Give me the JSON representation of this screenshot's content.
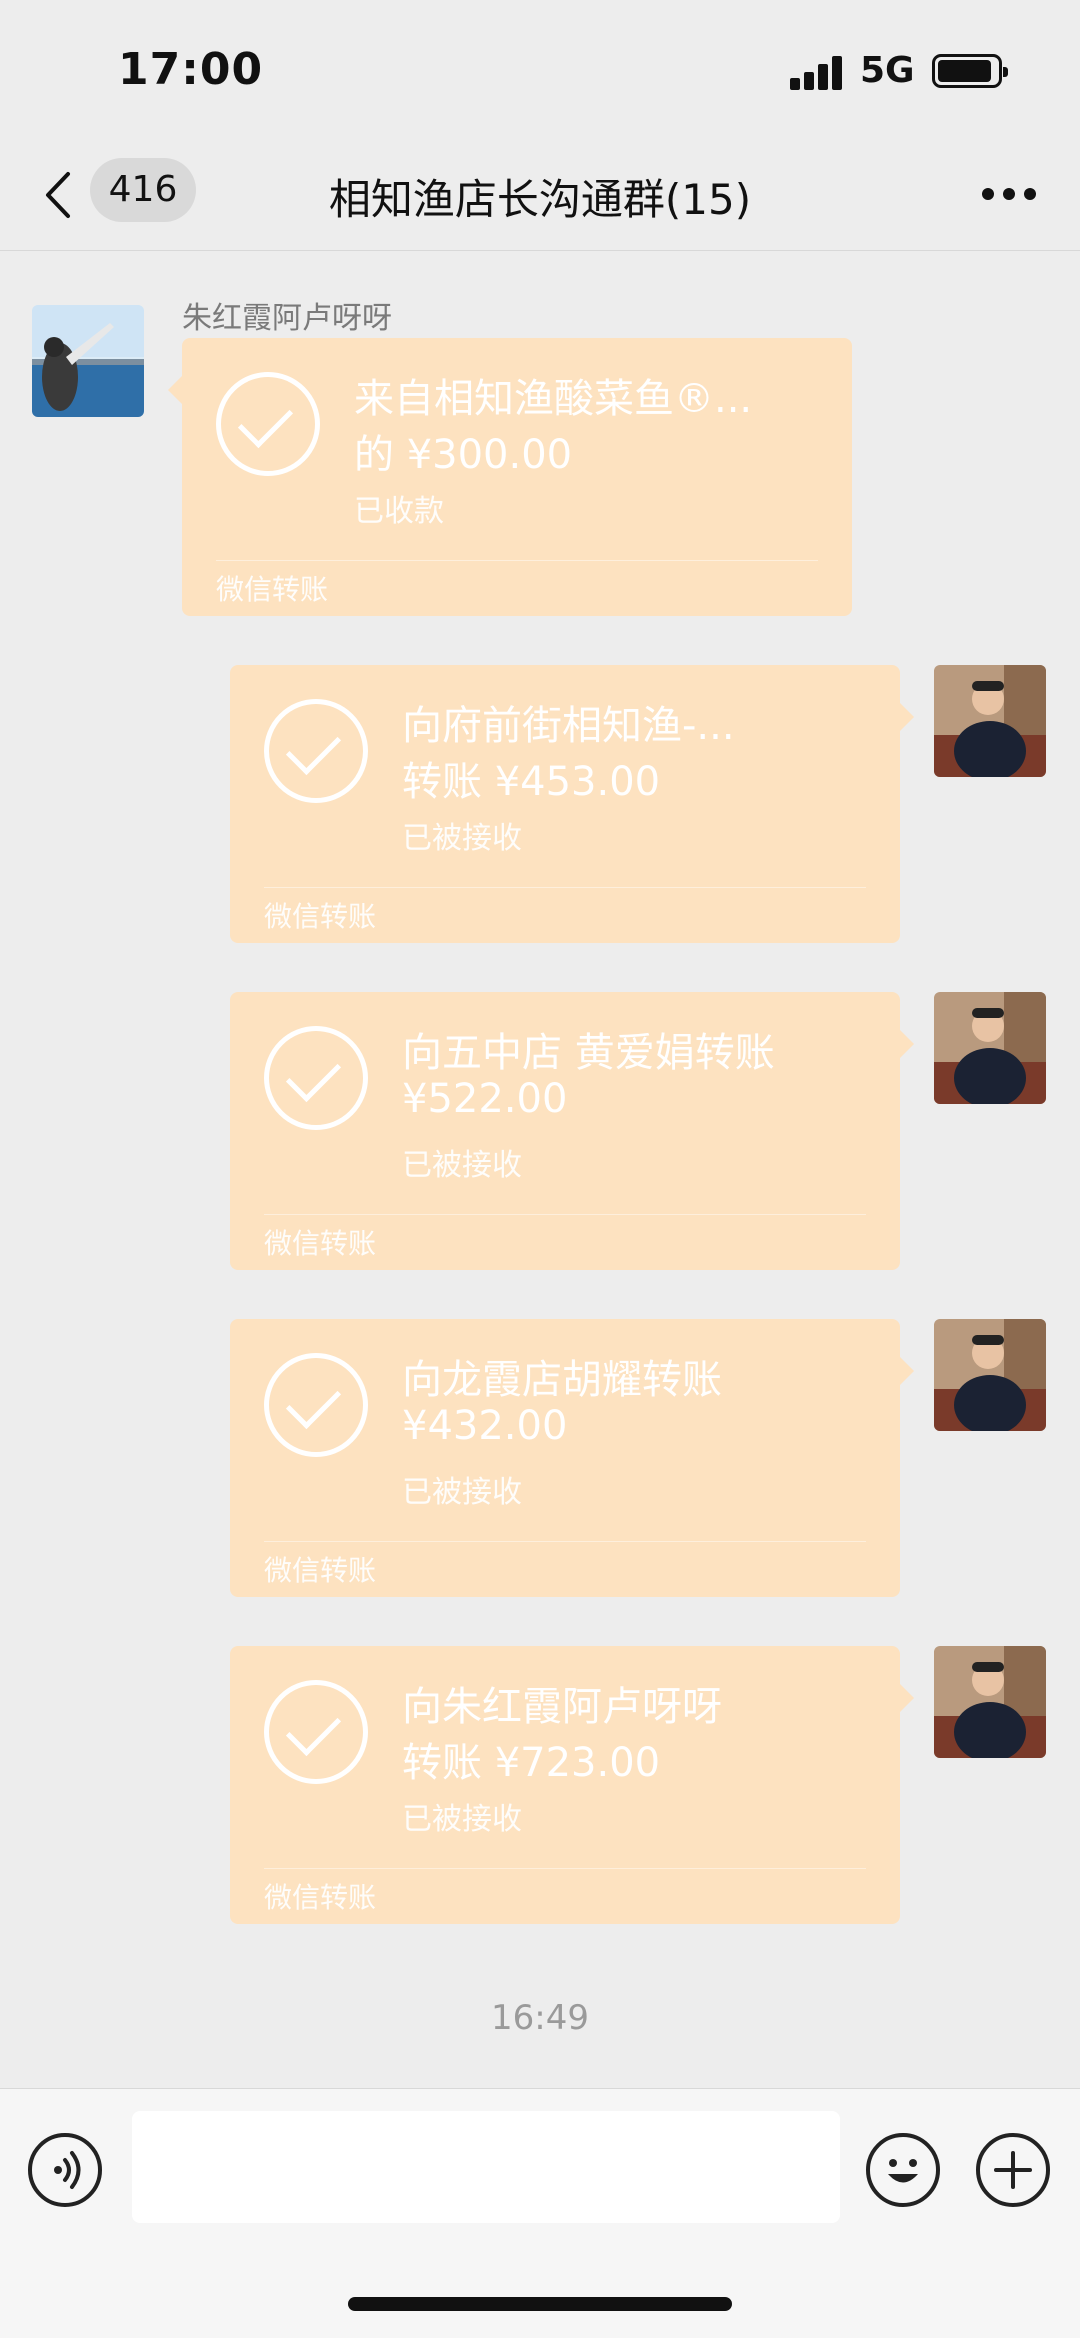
{
  "status_bar": {
    "time": "17:00",
    "network": "5G"
  },
  "header": {
    "back_badge": "416",
    "title": "相知渔店长沟通群(15)"
  },
  "messages": [
    {
      "sender": "朱红霞阿卢呀呀",
      "line1": "来自相知渔酸菜鱼®...",
      "line2": "的 ¥300.00",
      "status": "已收款",
      "footer": "微信转账"
    },
    {
      "line1": "向府前街相知渔-...",
      "line2": "转账 ¥453.00",
      "status": "已被接收",
      "footer": "微信转账"
    },
    {
      "line1": "向五中店 黄爱娟转账",
      "line2": "¥522.00",
      "status": "已被接收",
      "footer": "微信转账"
    },
    {
      "line1": "向龙霞店胡耀转账",
      "line2": "¥432.00",
      "status": "已被接收",
      "footer": "微信转账"
    },
    {
      "line1": "向朱红霞阿卢呀呀",
      "line2": "转账 ¥723.00",
      "status": "已被接收",
      "footer": "微信转账"
    }
  ],
  "timestamp": "16:49",
  "colors": {
    "card": "#fde2c0",
    "background": "#ededed"
  },
  "icons": [
    "back-chevron-icon",
    "more-icon",
    "check-circle-icon",
    "voice-icon",
    "emoji-icon",
    "plus-icon"
  ]
}
